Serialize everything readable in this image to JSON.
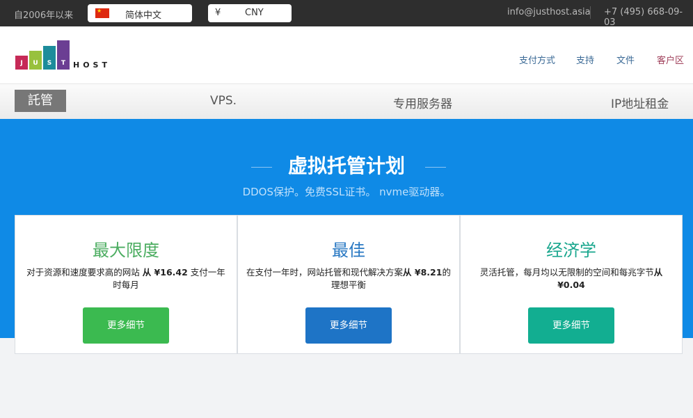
{
  "topbar": {
    "since": "自2006年以来",
    "language": {
      "label": "简体中文"
    },
    "currency": {
      "symbol": "¥",
      "label": "CNY"
    },
    "email": "info@justhost.asia",
    "phone": "+7 (495) 668-09-03"
  },
  "logo": {
    "letters": [
      "J",
      "U",
      "S",
      "T"
    ],
    "host": "HOST"
  },
  "header_nav": [
    "支付方式",
    "支持",
    "文件",
    "客户区"
  ],
  "menu": {
    "active": "託管",
    "items": [
      "VPS.",
      "专用服务器",
      "IP地址租金"
    ]
  },
  "hero": {
    "title": "虚拟托管计划",
    "subtitle": "DDOS保护。免费SSL证书。 nvme驱动器。"
  },
  "plans": [
    {
      "title": "最大限度",
      "desc_pre": "对于资源和速度要求高的网站 ",
      "desc_price": "从 ¥16.42",
      "desc_post": " 支付一年时每月",
      "button": "更多细节",
      "color": "#4cad61",
      "button_color": "#3bba50"
    },
    {
      "title": "最佳",
      "desc_pre": "在支付一年时，网站托管和现代解决方案",
      "desc_price": "从 ¥8.21",
      "desc_post": "的理想平衡",
      "button": "更多细节",
      "color": "#2a79c3",
      "button_color": "#1e74c6"
    },
    {
      "title": "经济学",
      "desc_pre": "灵活托管，每月均以无限制的空间和每兆字节",
      "desc_price": "从 ¥0.04",
      "desc_post": "",
      "button": "更多细节",
      "color": "#18a68d",
      "button_color": "#12ae91"
    }
  ]
}
